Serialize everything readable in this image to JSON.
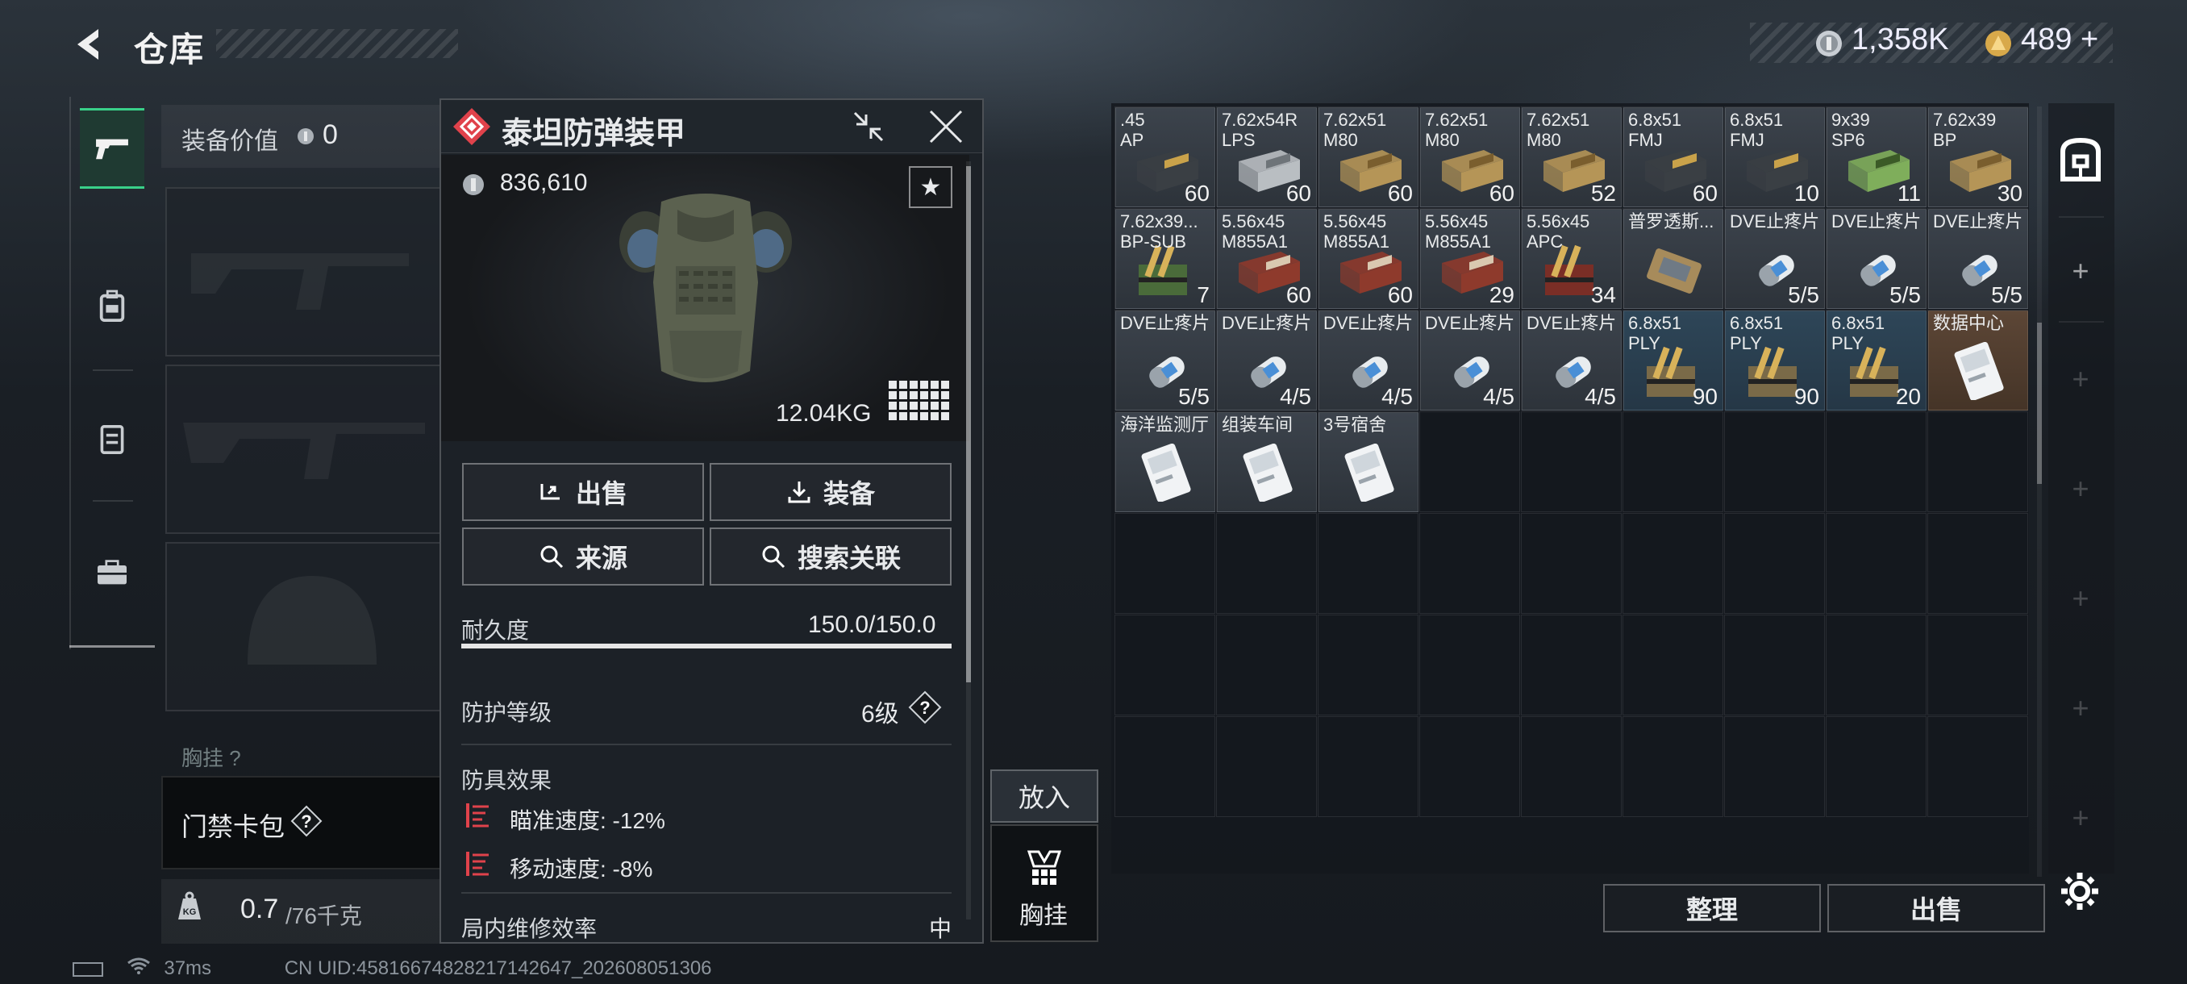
{
  "header": {
    "title": "仓库",
    "currency1": "1,358K",
    "currency2": "489",
    "currency2_plus": "+"
  },
  "equipment": {
    "value_label": "装备价值",
    "value": "0",
    "chest_rig_label": "胸挂 ?",
    "keycard_label": "门禁卡包",
    "weight_current": "0.7",
    "weight_max": "/76千克"
  },
  "item_panel": {
    "name": "泰坦防弹装甲",
    "price": "836,610",
    "weight": "12.04KG",
    "buttons": {
      "sell": "出售",
      "equip": "装备",
      "source": "来源",
      "search_related": "搜索关联"
    },
    "durability_label": "耐久度",
    "durability_value": "150.0/150.0",
    "durability_fraction": 1.0,
    "protection_label": "防护等级",
    "protection_value": "6级",
    "effects_label": "防具效果",
    "effects": [
      "瞄准速度: -12%",
      "移动速度: -8%"
    ],
    "repair_label": "局内维修效率",
    "repair_value": "中"
  },
  "put_in": {
    "label": "放入",
    "target": "胸挂"
  },
  "stash": {
    "items": [
      {
        "name": ".45\nAP",
        "count": "60",
        "icon": "ammo-box-dark"
      },
      {
        "name": "7.62x54R\nLPS",
        "count": "60",
        "icon": "ammo-box-silver"
      },
      {
        "name": "7.62x51\nM80",
        "count": "60",
        "icon": "ammo-box-tan"
      },
      {
        "name": "7.62x51\nM80",
        "count": "60",
        "icon": "ammo-box-tan"
      },
      {
        "name": "7.62x51\nM80",
        "count": "52",
        "icon": "ammo-box-tan"
      },
      {
        "name": "6.8x51\nFMJ",
        "count": "60",
        "icon": "ammo-box-dark"
      },
      {
        "name": "6.8x51\nFMJ",
        "count": "10",
        "icon": "ammo-box-dark"
      },
      {
        "name": "9x39\nSP6",
        "count": "11",
        "icon": "ammo-box-green"
      },
      {
        "name": "7.62x39\nBP",
        "count": "30",
        "icon": "ammo-box-tan"
      },
      {
        "name": "7.62x39...\nBP-SUB",
        "count": "7",
        "icon": "ammo-rounds-green"
      },
      {
        "name": "5.56x45\nM855A1",
        "count": "60",
        "icon": "ammo-box-red"
      },
      {
        "name": "5.56x45\nM855A1",
        "count": "60",
        "icon": "ammo-box-red"
      },
      {
        "name": "5.56x45\nM855A1",
        "count": "29",
        "icon": "ammo-box-red"
      },
      {
        "name": "5.56x45\nAPC",
        "count": "34",
        "icon": "ammo-rounds-red"
      },
      {
        "name": "普罗透斯...",
        "count": "",
        "icon": "device-icon"
      },
      {
        "name": "DVE止疼片",
        "count": "5/5",
        "icon": "pill-icon"
      },
      {
        "name": "DVE止疼片",
        "count": "5/5",
        "icon": "pill-icon"
      },
      {
        "name": "DVE止疼片",
        "count": "5/5",
        "icon": "pill-icon"
      },
      {
        "name": "DVE止疼片",
        "count": "5/5",
        "icon": "pill-icon"
      },
      {
        "name": "DVE止疼片",
        "count": "4/5",
        "icon": "pill-icon"
      },
      {
        "name": "DVE止疼片",
        "count": "4/5",
        "icon": "pill-icon"
      },
      {
        "name": "DVE止疼片",
        "count": "4/5",
        "icon": "pill-icon"
      },
      {
        "name": "DVE止疼片",
        "count": "4/5",
        "icon": "pill-icon"
      },
      {
        "name": "6.8x51\nPLY",
        "count": "90",
        "icon": "ammo-rounds-tan"
      },
      {
        "name": "6.8x51\nPLY",
        "count": "90",
        "icon": "ammo-rounds-tan"
      },
      {
        "name": "6.8x51\nPLY",
        "count": "20",
        "icon": "ammo-rounds-tan"
      },
      {
        "name": "数据中心",
        "count": "",
        "icon": "keycard-icon"
      },
      {
        "name": "海洋监测厅",
        "count": "",
        "icon": "keycard-icon"
      },
      {
        "name": "组装车间",
        "count": "",
        "icon": "keycard-icon"
      },
      {
        "name": "3号宿舍",
        "count": "",
        "icon": "keycard-icon"
      }
    ],
    "sort_label": "整理",
    "sell_label": "出售"
  },
  "status_bar": {
    "ping": "37ms",
    "uid": "CN UID:4581667482821714264​7_202608051306"
  },
  "colors": {
    "accent_green": "#39d089",
    "rarity_red": "#e0424b",
    "effect_red": "#e0424b"
  }
}
